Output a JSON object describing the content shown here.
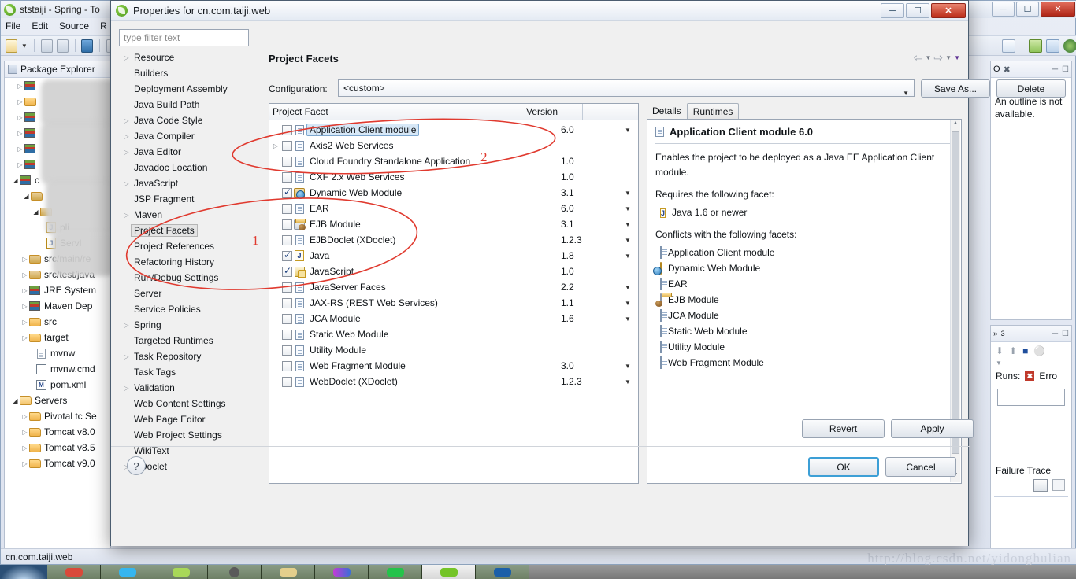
{
  "eclipse": {
    "window_title": "ststaiji - Spring - To",
    "menu": [
      "File",
      "Edit",
      "Source",
      "R"
    ],
    "window_buttons": [
      "minimize",
      "restore",
      "close"
    ],
    "package_explorer": {
      "tab_label": "Package Explorer",
      "items": [
        {
          "label": "",
          "icon": "maven-project-icon",
          "arrow": "collapsed",
          "blurred": true
        },
        {
          "label": "",
          "icon": "web-project-icon",
          "arrow": "collapsed",
          "blurred": true
        },
        {
          "label": "",
          "icon": "maven-project-icon",
          "arrow": "collapsed",
          "blurred": true
        },
        {
          "label": "",
          "icon": "maven-project-icon",
          "arrow": "collapsed",
          "blurred": true
        },
        {
          "label": "",
          "icon": "maven-project-icon",
          "arrow": "collapsed",
          "blurred": true
        },
        {
          "label": "",
          "icon": "maven-project-icon",
          "arrow": "collapsed",
          "blurred": true
        },
        {
          "label": "c",
          "icon": "maven-project-icon",
          "arrow": "expanded",
          "blurred": true
        },
        {
          "label": "",
          "icon": "package-folder-icon",
          "arrow": "expanded",
          "blurred": true
        },
        {
          "label": "",
          "icon": "package-folder-icon",
          "arrow": "expanded",
          "blurred": true
        },
        {
          "label": "pli",
          "icon": "java-class-icon",
          "arrow": "none",
          "blurred": true
        },
        {
          "label": "Servl",
          "icon": "java-class-icon",
          "arrow": "none",
          "blurred": false
        },
        {
          "label": "src/main/re",
          "icon": "source-folder-icon",
          "arrow": "collapsed",
          "blurred": false
        },
        {
          "label": "src/test/java",
          "icon": "source-folder-icon",
          "arrow": "collapsed",
          "blurred": false
        },
        {
          "label": "JRE System",
          "icon": "library-icon",
          "arrow": "collapsed",
          "blurred": false
        },
        {
          "label": "Maven Dep",
          "icon": "library-icon",
          "arrow": "collapsed",
          "blurred": false
        },
        {
          "label": "src",
          "icon": "folder-icon",
          "arrow": "collapsed",
          "blurred": false
        },
        {
          "label": "target",
          "icon": "folder-icon",
          "arrow": "collapsed",
          "blurred": false
        },
        {
          "label": "mvnw",
          "icon": "file-icon",
          "arrow": "none",
          "blurred": false
        },
        {
          "label": "mvnw.cmd",
          "icon": "cmd-file-icon",
          "arrow": "none",
          "blurred": false
        },
        {
          "label": "pom.xml",
          "icon": "xml-file-icon",
          "arrow": "none",
          "blurred": false
        },
        {
          "label": "Servers",
          "icon": "folder-open-icon",
          "arrow": "expanded",
          "blurred": false
        },
        {
          "label": "Pivotal tc Se",
          "icon": "folder-icon",
          "arrow": "collapsed",
          "blurred": false
        },
        {
          "label": "Tomcat v8.0",
          "icon": "folder-icon",
          "arrow": "collapsed",
          "blurred": false
        },
        {
          "label": "Tomcat v8.5",
          "icon": "folder-icon",
          "arrow": "collapsed",
          "blurred": false
        },
        {
          "label": "Tomcat v9.0",
          "icon": "folder-icon",
          "arrow": "collapsed",
          "blurred": false
        }
      ]
    },
    "outline_view": {
      "tab_label": "O",
      "message": "An outline is not available."
    },
    "junit_view": {
      "tab_label": "3",
      "runs_label": "Runs:",
      "errors_label": "Erro",
      "failure_trace_label": "Failure Trace"
    },
    "status_bar": "cn.com.taiji.web",
    "watermark": "http://blog.csdn.net/yidonghulian"
  },
  "dialog": {
    "title": "Properties for cn.com.taiji.web",
    "window_buttons": [
      "minimize",
      "restore",
      "close"
    ],
    "filter": {
      "placeholder": "type filter text",
      "value": ""
    },
    "nav_items": [
      {
        "label": "Resource",
        "arrow": "collapsed",
        "selected": false
      },
      {
        "label": "Builders",
        "arrow": "none",
        "selected": false
      },
      {
        "label": "Deployment Assembly",
        "arrow": "none",
        "selected": false
      },
      {
        "label": "Java Build Path",
        "arrow": "none",
        "selected": false
      },
      {
        "label": "Java Code Style",
        "arrow": "collapsed",
        "selected": false
      },
      {
        "label": "Java Compiler",
        "arrow": "collapsed",
        "selected": false
      },
      {
        "label": "Java Editor",
        "arrow": "collapsed",
        "selected": false
      },
      {
        "label": "Javadoc Location",
        "arrow": "none",
        "selected": false
      },
      {
        "label": "JavaScript",
        "arrow": "collapsed",
        "selected": false
      },
      {
        "label": "JSP Fragment",
        "arrow": "none",
        "selected": false
      },
      {
        "label": "Maven",
        "arrow": "collapsed",
        "selected": false
      },
      {
        "label": "Project Facets",
        "arrow": "none",
        "selected": true
      },
      {
        "label": "Project References",
        "arrow": "none",
        "selected": false
      },
      {
        "label": "Refactoring History",
        "arrow": "none",
        "selected": false
      },
      {
        "label": "Run/Debug Settings",
        "arrow": "none",
        "selected": false
      },
      {
        "label": "Server",
        "arrow": "none",
        "selected": false
      },
      {
        "label": "Service Policies",
        "arrow": "none",
        "selected": false
      },
      {
        "label": "Spring",
        "arrow": "collapsed",
        "selected": false
      },
      {
        "label": "Targeted Runtimes",
        "arrow": "none",
        "selected": false
      },
      {
        "label": "Task Repository",
        "arrow": "collapsed",
        "selected": false
      },
      {
        "label": "Task Tags",
        "arrow": "none",
        "selected": false
      },
      {
        "label": "Validation",
        "arrow": "collapsed",
        "selected": false
      },
      {
        "label": "Web Content Settings",
        "arrow": "none",
        "selected": false
      },
      {
        "label": "Web Page Editor",
        "arrow": "none",
        "selected": false
      },
      {
        "label": "Web Project Settings",
        "arrow": "none",
        "selected": false
      },
      {
        "label": "WikiText",
        "arrow": "none",
        "selected": false
      },
      {
        "label": "XDoclet",
        "arrow": "collapsed",
        "selected": false
      }
    ],
    "page_title": "Project Facets",
    "configuration": {
      "label": "Configuration:",
      "value": "<custom>",
      "save_as_label": "Save As...",
      "delete_label": "Delete"
    },
    "facet_table": {
      "columns": [
        "Project Facet",
        "Version"
      ],
      "rows": [
        {
          "name": "Application Client module",
          "version": "6.0",
          "checked": false,
          "selected": true,
          "icon": "doc-icon",
          "expandable": false,
          "has_version_menu": true
        },
        {
          "name": "Axis2 Web Services",
          "version": "",
          "checked": false,
          "selected": false,
          "icon": "doc-icon",
          "expandable": true,
          "has_version_menu": false
        },
        {
          "name": "Cloud Foundry Standalone Application",
          "version": "1.0",
          "checked": false,
          "selected": false,
          "icon": "doc-icon",
          "expandable": false,
          "has_version_menu": false
        },
        {
          "name": "CXF 2.x Web Services",
          "version": "1.0",
          "checked": false,
          "selected": false,
          "icon": "doc-icon",
          "expandable": false,
          "has_version_menu": false
        },
        {
          "name": "Dynamic Web Module",
          "version": "3.1",
          "checked": true,
          "selected": false,
          "icon": "web-icon",
          "expandable": false,
          "has_version_menu": true
        },
        {
          "name": "EAR",
          "version": "6.0",
          "checked": false,
          "selected": false,
          "icon": "doc-icon",
          "expandable": false,
          "has_version_menu": true
        },
        {
          "name": "EJB Module",
          "version": "3.1",
          "checked": false,
          "selected": false,
          "icon": "ejb-icon",
          "expandable": false,
          "has_version_menu": true
        },
        {
          "name": "EJBDoclet (XDoclet)",
          "version": "1.2.3",
          "checked": false,
          "selected": false,
          "icon": "doc-icon",
          "expandable": false,
          "has_version_menu": true
        },
        {
          "name": "Java",
          "version": "1.8",
          "checked": true,
          "selected": false,
          "icon": "java-icon",
          "expandable": false,
          "has_version_menu": true
        },
        {
          "name": "JavaScript",
          "version": "1.0",
          "checked": true,
          "selected": false,
          "icon": "js-icon",
          "expandable": false,
          "has_version_menu": false
        },
        {
          "name": "JavaServer Faces",
          "version": "2.2",
          "checked": false,
          "selected": false,
          "icon": "doc-icon",
          "expandable": false,
          "has_version_menu": true
        },
        {
          "name": "JAX-RS (REST Web Services)",
          "version": "1.1",
          "checked": false,
          "selected": false,
          "icon": "doc-icon",
          "expandable": false,
          "has_version_menu": true
        },
        {
          "name": "JCA Module",
          "version": "1.6",
          "checked": false,
          "selected": false,
          "icon": "doc-icon",
          "expandable": false,
          "has_version_menu": true
        },
        {
          "name": "Static Web Module",
          "version": "",
          "checked": false,
          "selected": false,
          "icon": "doc-icon",
          "expandable": false,
          "has_version_menu": false
        },
        {
          "name": "Utility Module",
          "version": "",
          "checked": false,
          "selected": false,
          "icon": "doc-icon",
          "expandable": false,
          "has_version_menu": false
        },
        {
          "name": "Web Fragment Module",
          "version": "3.0",
          "checked": false,
          "selected": false,
          "icon": "doc-icon",
          "expandable": false,
          "has_version_menu": true
        },
        {
          "name": "WebDoclet (XDoclet)",
          "version": "1.2.3",
          "checked": false,
          "selected": false,
          "icon": "doc-icon",
          "expandable": false,
          "has_version_menu": true
        }
      ]
    },
    "details": {
      "tabs": [
        {
          "label": "Details",
          "active": true
        },
        {
          "label": "Runtimes",
          "active": false
        }
      ],
      "header": "Application Client module 6.0",
      "description": "Enables the project to be deployed as a Java EE Application Client module.",
      "requires_label": "Requires the following facet:",
      "requires": [
        {
          "label": "Java 1.6 or newer",
          "icon": "java-icon"
        }
      ],
      "conflicts_label": "Conflicts with the following facets:",
      "conflicts": [
        {
          "label": "Application Client module",
          "icon": "doc-icon"
        },
        {
          "label": "Dynamic Web Module",
          "icon": "web-icon"
        },
        {
          "label": "EAR",
          "icon": "doc-icon"
        },
        {
          "label": "EJB Module",
          "icon": "ejb-icon"
        },
        {
          "label": "JCA Module",
          "icon": "doc-icon"
        },
        {
          "label": "Static Web Module",
          "icon": "doc-icon"
        },
        {
          "label": "Utility Module",
          "icon": "doc-icon"
        },
        {
          "label": "Web Fragment Module",
          "icon": "doc-icon"
        }
      ]
    },
    "buttons": {
      "revert": "Revert",
      "apply": "Apply",
      "ok": "OK",
      "cancel": "Cancel",
      "help": "?"
    }
  },
  "annotations": {
    "color": "#e03a2f",
    "marks": [
      {
        "text": "1"
      },
      {
        "text": "2"
      }
    ]
  }
}
